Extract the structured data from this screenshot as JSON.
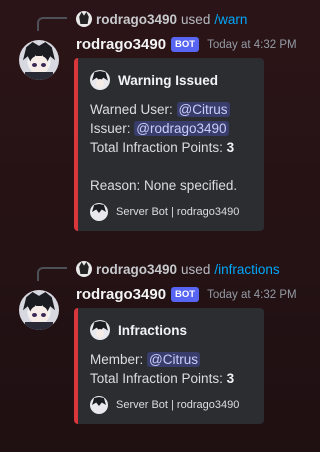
{
  "messages": [
    {
      "reply": {
        "user": "rodrago3490",
        "used": "used",
        "command": "/warn"
      },
      "username": "rodrago3490",
      "bot_tag": "BOT",
      "timestamp": "Today at 4:32 PM",
      "embed": {
        "title": "Warning Issued",
        "line1_label": "Warned User:",
        "line1_mention": "@Citrus",
        "line2_label": "Issuer:",
        "line2_mention": "@rodrago3490",
        "line3_label": "Total Infraction Points:",
        "line3_value": "3",
        "line4": "Reason: None specified.",
        "footer": "Server Bot | rodrago3490",
        "accent_color": "#da373c"
      }
    },
    {
      "reply": {
        "user": "rodrago3490",
        "used": "used",
        "command": "/infractions"
      },
      "username": "rodrago3490",
      "bot_tag": "BOT",
      "timestamp": "Today at 4:32 PM",
      "embed": {
        "title": "Infractions",
        "line1_label": "Member:",
        "line1_mention": "@Citrus",
        "line2_label": "Total Infraction Points:",
        "line2_value": "3",
        "footer": "Server Bot | rodrago3490",
        "accent_color": "#da373c"
      }
    }
  ],
  "colors": {
    "bot_tag": "#5865f2",
    "command_link": "#00a8fc",
    "embed_bg": "#2b2d31",
    "mention_bg": "#3c4270"
  },
  "icons": {
    "avatar": "anime-character-avatar",
    "reply_avatar": "anime-character-mini-avatar"
  }
}
